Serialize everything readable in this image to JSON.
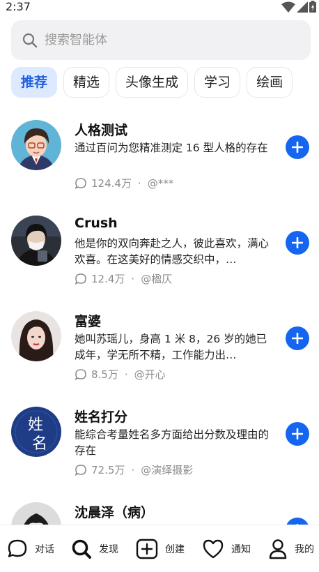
{
  "status_bar": {
    "time": "2:37"
  },
  "search": {
    "placeholder": "搜索智能体",
    "icon": "search-icon"
  },
  "categories": [
    {
      "label": "推荐",
      "active": true
    },
    {
      "label": "精选",
      "active": false
    },
    {
      "label": "头像生成",
      "active": false
    },
    {
      "label": "学习",
      "active": false
    },
    {
      "label": "绘画",
      "active": false
    }
  ],
  "agents": [
    {
      "title": "人格测试",
      "description": "通过百问为您精准测定 16 型人格的存在",
      "count": "124.4万",
      "author": "@***"
    },
    {
      "title": "Crush",
      "description": "他是你的双向奔赴之人，彼此喜欢，满心欢喜。在这美好的情感交织中，…",
      "count": "12.4万",
      "author": "@楹仄"
    },
    {
      "title": "富婆",
      "description": "她叫苏瑶儿，身高 1 米 8，26 岁的她已成年，学无所不精，工作能力出…",
      "count": "8.5万",
      "author": "@开心"
    },
    {
      "title": "姓名打分",
      "description": "能综合考量姓名多方面给出分数及理由的存在",
      "count": "72.5万",
      "author": "@演绎摄影"
    },
    {
      "title": "沈晨泽（病）",
      "description": "",
      "count": "",
      "author": ""
    }
  ],
  "avatar_logo_text": [
    "姓",
    "名"
  ],
  "bottom_nav": [
    {
      "label": "对话",
      "icon": "chat-icon"
    },
    {
      "label": "发现",
      "icon": "search-icon"
    },
    {
      "label": "创建",
      "icon": "add-square-icon"
    },
    {
      "label": "通知",
      "icon": "heart-icon"
    },
    {
      "label": "我的",
      "icon": "person-icon"
    }
  ],
  "colors": {
    "accent": "#1565f0",
    "chip_active_bg": "#dde9ff",
    "search_bg": "#f1f1f3"
  }
}
